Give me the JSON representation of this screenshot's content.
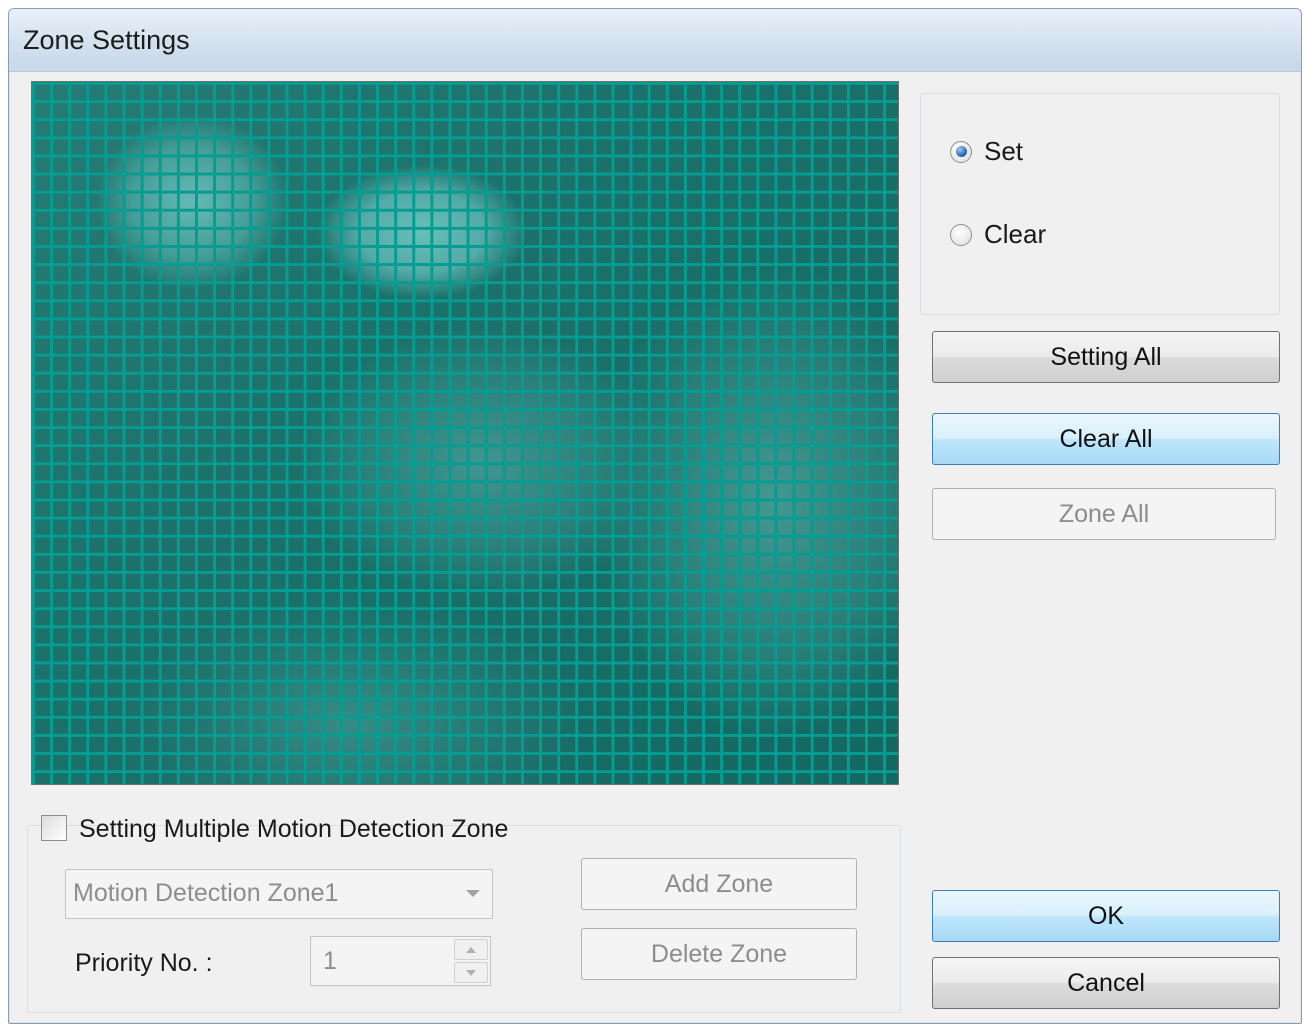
{
  "window": {
    "title": "Zone Settings"
  },
  "mode": {
    "options": [
      {
        "label": "Set",
        "selected": true
      },
      {
        "label": "Clear",
        "selected": false
      }
    ]
  },
  "actions": {
    "setting_all": "Setting All",
    "clear_all": "Clear All",
    "zone_all": "Zone All"
  },
  "multi_zone": {
    "checkbox_label": "Setting Multiple Motion Detection Zone",
    "checked": false,
    "zone_select_value": "Motion Detection Zone1",
    "priority_label": "Priority No. :",
    "priority_value": "1",
    "add_zone": "Add Zone",
    "delete_zone": "Delete Zone"
  },
  "footer": {
    "ok": "OK",
    "cancel": "Cancel"
  },
  "colors": {
    "grid": "#0aa39a",
    "accent": "#3c7fb1"
  }
}
